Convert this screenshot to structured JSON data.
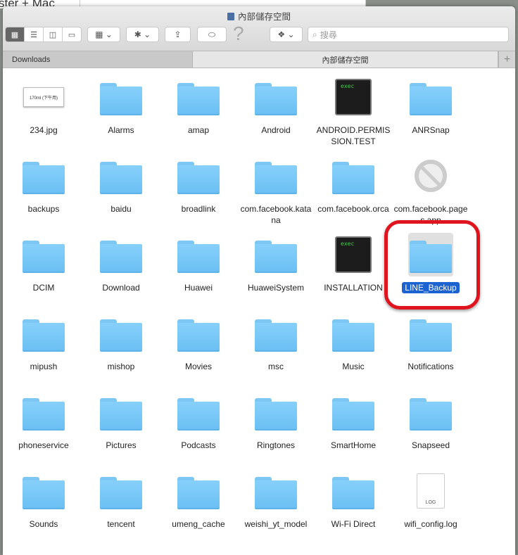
{
  "background": {
    "text": "ster + Mac"
  },
  "window": {
    "title": "內部儲存空間"
  },
  "toolbar": {
    "search_placeholder": "搜尋",
    "help": "?"
  },
  "tabs": [
    {
      "label": "Downloads"
    },
    {
      "label": "內部儲存空間"
    }
  ],
  "tab_add": "+",
  "thumbnail_text": "170ml (下午用)",
  "items": [
    {
      "name": "234.jpg",
      "type": "image"
    },
    {
      "name": "Alarms",
      "type": "folder"
    },
    {
      "name": "amap",
      "type": "folder"
    },
    {
      "name": "Android",
      "type": "folder"
    },
    {
      "name": "ANDROID.PERMISSION.TEST",
      "type": "exec"
    },
    {
      "name": "ANRSnap",
      "type": "folder"
    },
    {
      "name": "backups",
      "type": "folder"
    },
    {
      "name": "baidu",
      "type": "folder"
    },
    {
      "name": "broadlink",
      "type": "folder"
    },
    {
      "name": "com.facebook.katana",
      "type": "folder"
    },
    {
      "name": "com.facebook.orca",
      "type": "folder"
    },
    {
      "name": "com.facebook.pages.app",
      "type": "app"
    },
    {
      "name": "DCIM",
      "type": "folder"
    },
    {
      "name": "Download",
      "type": "folder"
    },
    {
      "name": "Huawei",
      "type": "folder"
    },
    {
      "name": "HuaweiSystem",
      "type": "folder"
    },
    {
      "name": "INSTALLATION",
      "type": "exec"
    },
    {
      "name": "LINE_Backup",
      "type": "folder",
      "selected": true
    },
    {
      "name": "mipush",
      "type": "folder"
    },
    {
      "name": "mishop",
      "type": "folder"
    },
    {
      "name": "Movies",
      "type": "folder"
    },
    {
      "name": "msc",
      "type": "folder"
    },
    {
      "name": "Music",
      "type": "folder"
    },
    {
      "name": "Notifications",
      "type": "folder"
    },
    {
      "name": "phoneservice",
      "type": "folder"
    },
    {
      "name": "Pictures",
      "type": "folder"
    },
    {
      "name": "Podcasts",
      "type": "folder"
    },
    {
      "name": "Ringtones",
      "type": "folder"
    },
    {
      "name": "SmartHome",
      "type": "folder"
    },
    {
      "name": "Snapseed",
      "type": "folder"
    },
    {
      "name": "Sounds",
      "type": "folder"
    },
    {
      "name": "tencent",
      "type": "folder"
    },
    {
      "name": "umeng_cache",
      "type": "folder"
    },
    {
      "name": "weishi_yt_model",
      "type": "folder"
    },
    {
      "name": "Wi-Fi Direct",
      "type": "folder"
    },
    {
      "name": "wifi_config.log",
      "type": "log"
    }
  ],
  "exec_label": "exec",
  "log_label": "LOG",
  "colors": {
    "highlight_ring": "#e0141e",
    "selection": "#1d62d1",
    "folder": "#7cc7f3"
  }
}
